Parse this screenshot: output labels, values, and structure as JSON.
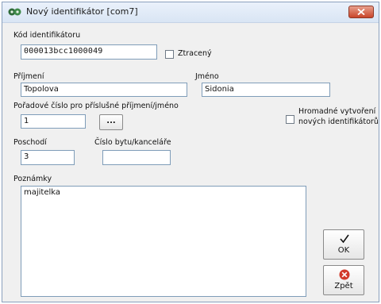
{
  "window": {
    "title": "Nový identifikátor [com7]"
  },
  "form": {
    "kod": {
      "label": "Kód identifikátoru",
      "value": "000013bcc1000049"
    },
    "ztraceny": {
      "label": "Ztracený",
      "checked": false
    },
    "prijmeni": {
      "label": "Příjmení",
      "value": "Topolova"
    },
    "jmeno": {
      "label": "Jméno",
      "value": "Sidonia"
    },
    "poradove": {
      "label": "Pořadové číslo pro příslušné příjmení/jméno",
      "value": "1",
      "button_label": "..."
    },
    "hromadne": {
      "label_line1": "Hromadné vytvoření",
      "label_line2": "nových identifikátorů",
      "checked": false
    },
    "poschodi": {
      "label": "Poschodí",
      "value": "3"
    },
    "cislo_bytu": {
      "label": "Číslo bytu/kanceláře",
      "value": ""
    },
    "poznamky": {
      "label": "Poznámky",
      "value": "majitelka"
    }
  },
  "buttons": {
    "ok": {
      "label": "OK",
      "icon": "checkmark-icon"
    },
    "zpet": {
      "label": "Zpět",
      "icon": "cancel-icon",
      "icon_color": "#d23a2a"
    }
  }
}
